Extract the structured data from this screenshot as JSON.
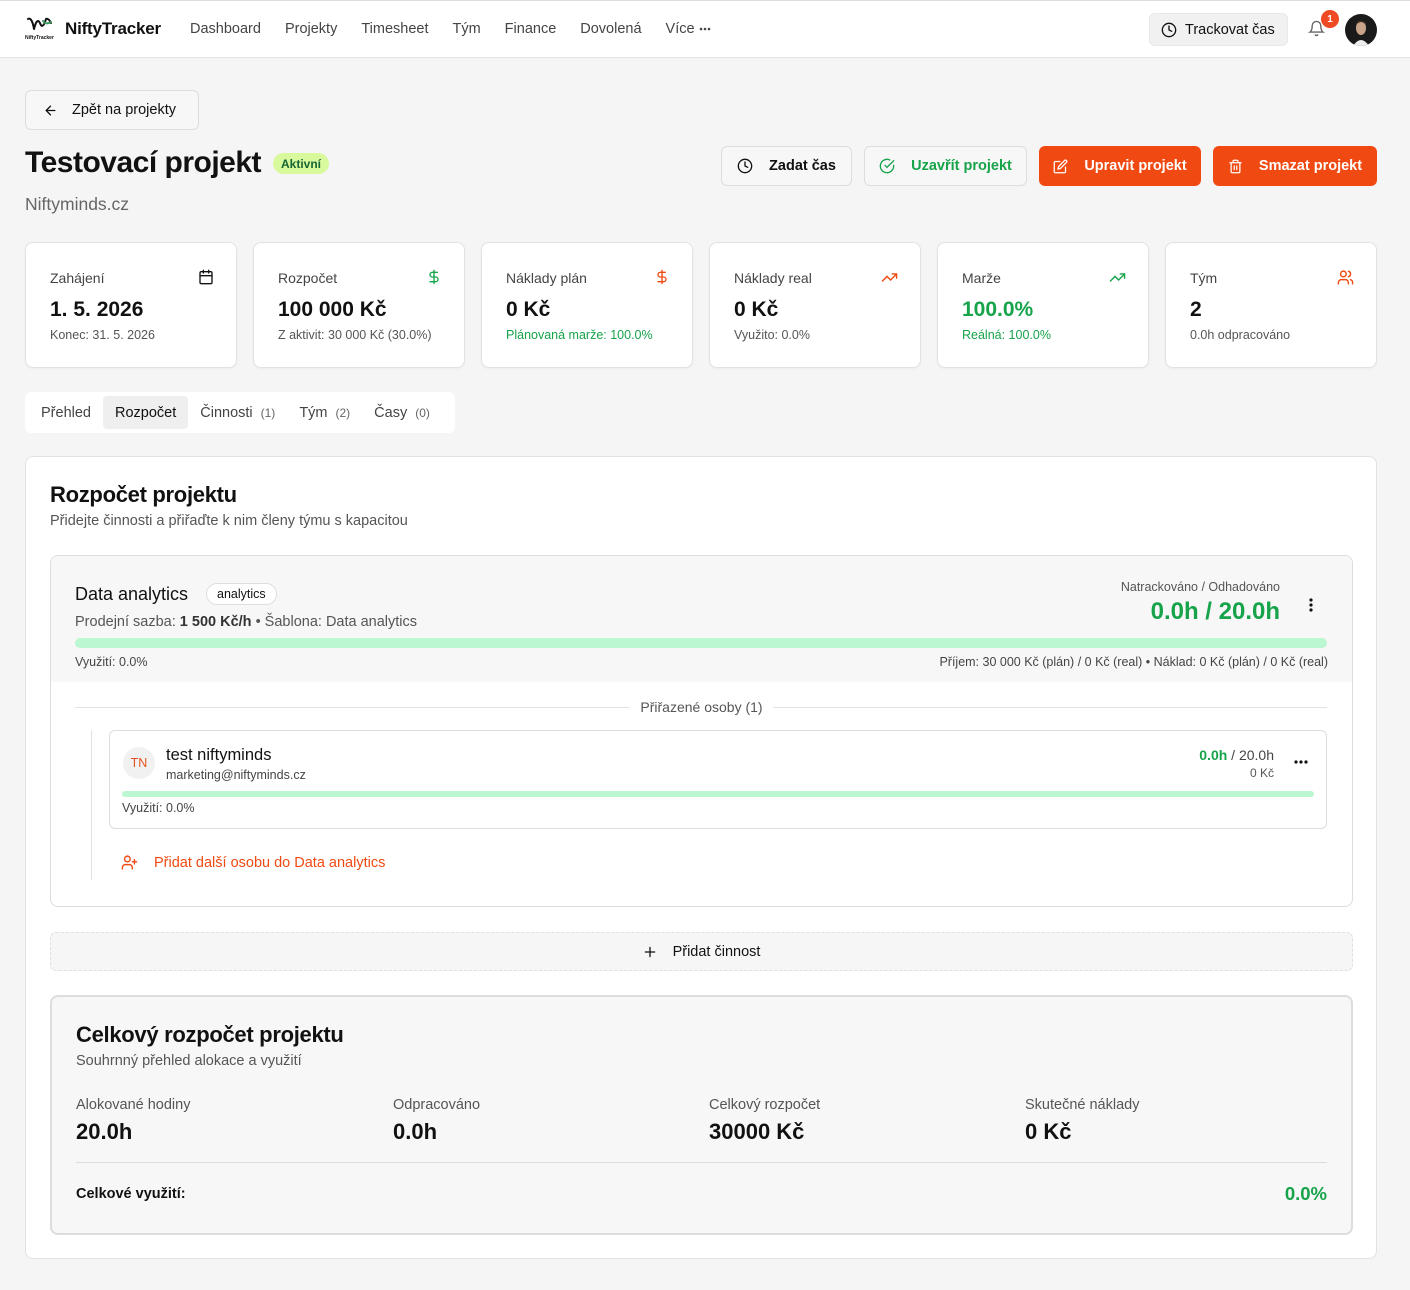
{
  "app": {
    "name": "NiftyTracker",
    "logo_small": "NiftyTracker"
  },
  "nav": {
    "items": [
      "Dashboard",
      "Projekty",
      "Timesheet",
      "Tým",
      "Finance",
      "Dovolená",
      "Více"
    ]
  },
  "topbar": {
    "track_label": "Trackovat čas",
    "notification_count": "1"
  },
  "back_label": "Zpět na projekty",
  "project": {
    "title": "Testovací projekt",
    "status": "Aktivní",
    "client": "Niftyminds.cz"
  },
  "actions": {
    "log_time": "Zadat čas",
    "close": "Uzavřít projekt",
    "edit": "Upravit projekt",
    "delete": "Smazat projekt"
  },
  "stats": [
    {
      "label": "Zahájení",
      "value": "1. 5. 2026",
      "sub": "Konec: 31. 5. 2026",
      "icon": "calendar-icon"
    },
    {
      "label": "Rozpočet",
      "value": "100 000 Kč",
      "sub": "Z aktivit: 30 000 Kč (30.0%)",
      "icon": "dollar-icon"
    },
    {
      "label": "Náklady plán",
      "value": "0 Kč",
      "sub": "Plánovaná marže: 100.0%",
      "icon": "dollar-icon"
    },
    {
      "label": "Náklady real",
      "value": "0 Kč",
      "sub": "Využito: 0.0%",
      "icon": "trending-up-icon"
    },
    {
      "label": "Marže",
      "value": "100.0%",
      "sub": "Reálná: 100.0%",
      "icon": "trending-up-icon"
    },
    {
      "label": "Tým",
      "value": "2",
      "sub": "0.0h odpracováno",
      "icon": "users-icon"
    }
  ],
  "tabs": [
    {
      "label": "Přehled",
      "count": ""
    },
    {
      "label": "Rozpočet",
      "count": ""
    },
    {
      "label": "Činnosti",
      "count": "(1)"
    },
    {
      "label": "Tým",
      "count": "(2)"
    },
    {
      "label": "Časy",
      "count": "(0)"
    }
  ],
  "budget": {
    "title": "Rozpočet projektu",
    "subtitle": "Přidejte činnosti a přiřaďte k nim členy týmu s kapacitou"
  },
  "activity": {
    "name": "Data analytics",
    "tag": "analytics",
    "rate_label": "Prodejní sazba:",
    "rate_value": "1 500 Kč/h",
    "template": "• Šablona: Data analytics",
    "tracked_label": "Natrackováno / Odhadováno",
    "tracked_value": "0.0h / 20.0h",
    "utilization": "Využití: 0.0%",
    "utilization_pct": 0,
    "finance": "Příjem: 30 000 Kč (plán) / 0 Kč (real) • Náklad: 0 Kč (plán) / 0 Kč (real)",
    "assigned_label": "Přiřazené osoby (1)",
    "add_person": "Přidat další osobu do Data analytics"
  },
  "person": {
    "initials": "TN",
    "name": "test niftyminds",
    "email": "marketing@niftyminds.cz",
    "hours_done": "0.0h",
    "hours_total": "/ 20.0h",
    "cost": "0 Kč",
    "utilization": "Využití: 0.0%"
  },
  "add_activity": "Přidat činnost",
  "summary": {
    "title": "Celkový rozpočet projektu",
    "subtitle": "Souhrnný přehled alokace a využití",
    "items": [
      {
        "label": "Alokované hodiny",
        "value": "20.0h"
      },
      {
        "label": "Odpracováno",
        "value": "0.0h"
      },
      {
        "label": "Celkový rozpočet",
        "value": "30000 Kč"
      },
      {
        "label": "Skutečné náklady",
        "value": "0 Kč"
      }
    ],
    "util_label": "Celkové využití:",
    "util_value": "0.0%"
  },
  "colors": {
    "accent": "#f04a12",
    "success": "#16a34a",
    "badge_bg": "#d9f99d",
    "progress": "#bbf7d0"
  }
}
